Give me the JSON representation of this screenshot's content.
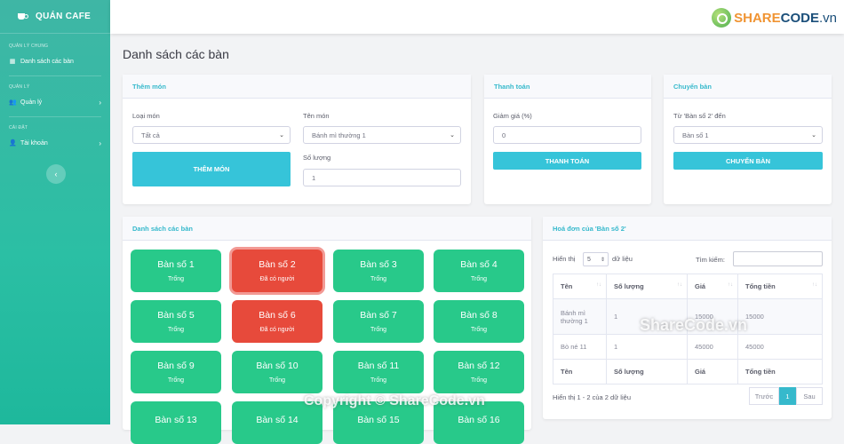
{
  "sidebar": {
    "brand": "QUÁN CAFE",
    "sec1": "QUẢN LÝ CHUNG",
    "item1": "Danh sách các bàn",
    "sec2": "QUẢN LÝ",
    "item2": "Quản lý",
    "sec3": "CÀI ĐẶT",
    "item3": "Tài khoản",
    "toggle": "‹"
  },
  "logo": {
    "part1": "SHARE",
    "part2": "CODE",
    "part3": ".vn"
  },
  "page_title": "Danh sách các bàn",
  "add_card": {
    "title": "Thêm món",
    "label_type": "Loại món",
    "type_value": "Tất cả",
    "label_name": "Tên món",
    "name_value": "Bánh mì thường 1",
    "label_qty": "Số lượng",
    "qty_value": "1",
    "button": "THÊM MÓN"
  },
  "pay_card": {
    "title": "Thanh toán",
    "label": "Giảm giá (%)",
    "value": "0",
    "button": "THANH TOÁN"
  },
  "move_card": {
    "title": "Chuyển bàn",
    "label": "Từ 'Bàn số 2' đến",
    "value": "Bàn số 1",
    "button": "CHUYỂN BÀN"
  },
  "tables_card": {
    "title": "Danh sách các bàn",
    "tables": [
      {
        "name": "Bàn số 1",
        "status": "Trống"
      },
      {
        "name": "Bàn số 2",
        "status": "Đã có người"
      },
      {
        "name": "Bàn số 3",
        "status": "Trống"
      },
      {
        "name": "Bàn số 4",
        "status": "Trống"
      },
      {
        "name": "Bàn số 5",
        "status": "Trống"
      },
      {
        "name": "Bàn số 6",
        "status": "Đã có người"
      },
      {
        "name": "Bàn số 7",
        "status": "Trống"
      },
      {
        "name": "Bàn số 8",
        "status": "Trống"
      },
      {
        "name": "Bàn số 9",
        "status": "Trống"
      },
      {
        "name": "Bàn số 10",
        "status": "Trống"
      },
      {
        "name": "Bàn số 11",
        "status": "Trống"
      },
      {
        "name": "Bàn số 12",
        "status": "Trống"
      },
      {
        "name": "Bàn số 13",
        "status": ""
      },
      {
        "name": "Bàn số 14",
        "status": ""
      },
      {
        "name": "Bàn số 15",
        "status": ""
      },
      {
        "name": "Bàn số 16",
        "status": ""
      }
    ]
  },
  "invoice": {
    "title": "Hoá đơn của 'Bàn số 2'",
    "show": "Hiển thị",
    "len": "5",
    "records": "dữ liệu",
    "search_label": "Tìm kiếm:",
    "headers": [
      "Tên",
      "Số lượng",
      "Giá",
      "Tổng tiền"
    ],
    "rows": [
      [
        "Bánh mì thường 1",
        "1",
        "15000",
        "15000"
      ],
      [
        "Bò né 11",
        "1",
        "45000",
        "45000"
      ]
    ],
    "info": "Hiển thị 1 - 2 của 2 dữ liệu",
    "prev": "Trước",
    "page": "1",
    "next": "Sau"
  },
  "watermarks": {
    "center": "ShareCode.vn",
    "bottom": "Copyright © ShareCode.vn"
  },
  "colors": {
    "occupied": "#e74a3b",
    "free": "#28c98a",
    "accent": "#36b9cc"
  }
}
